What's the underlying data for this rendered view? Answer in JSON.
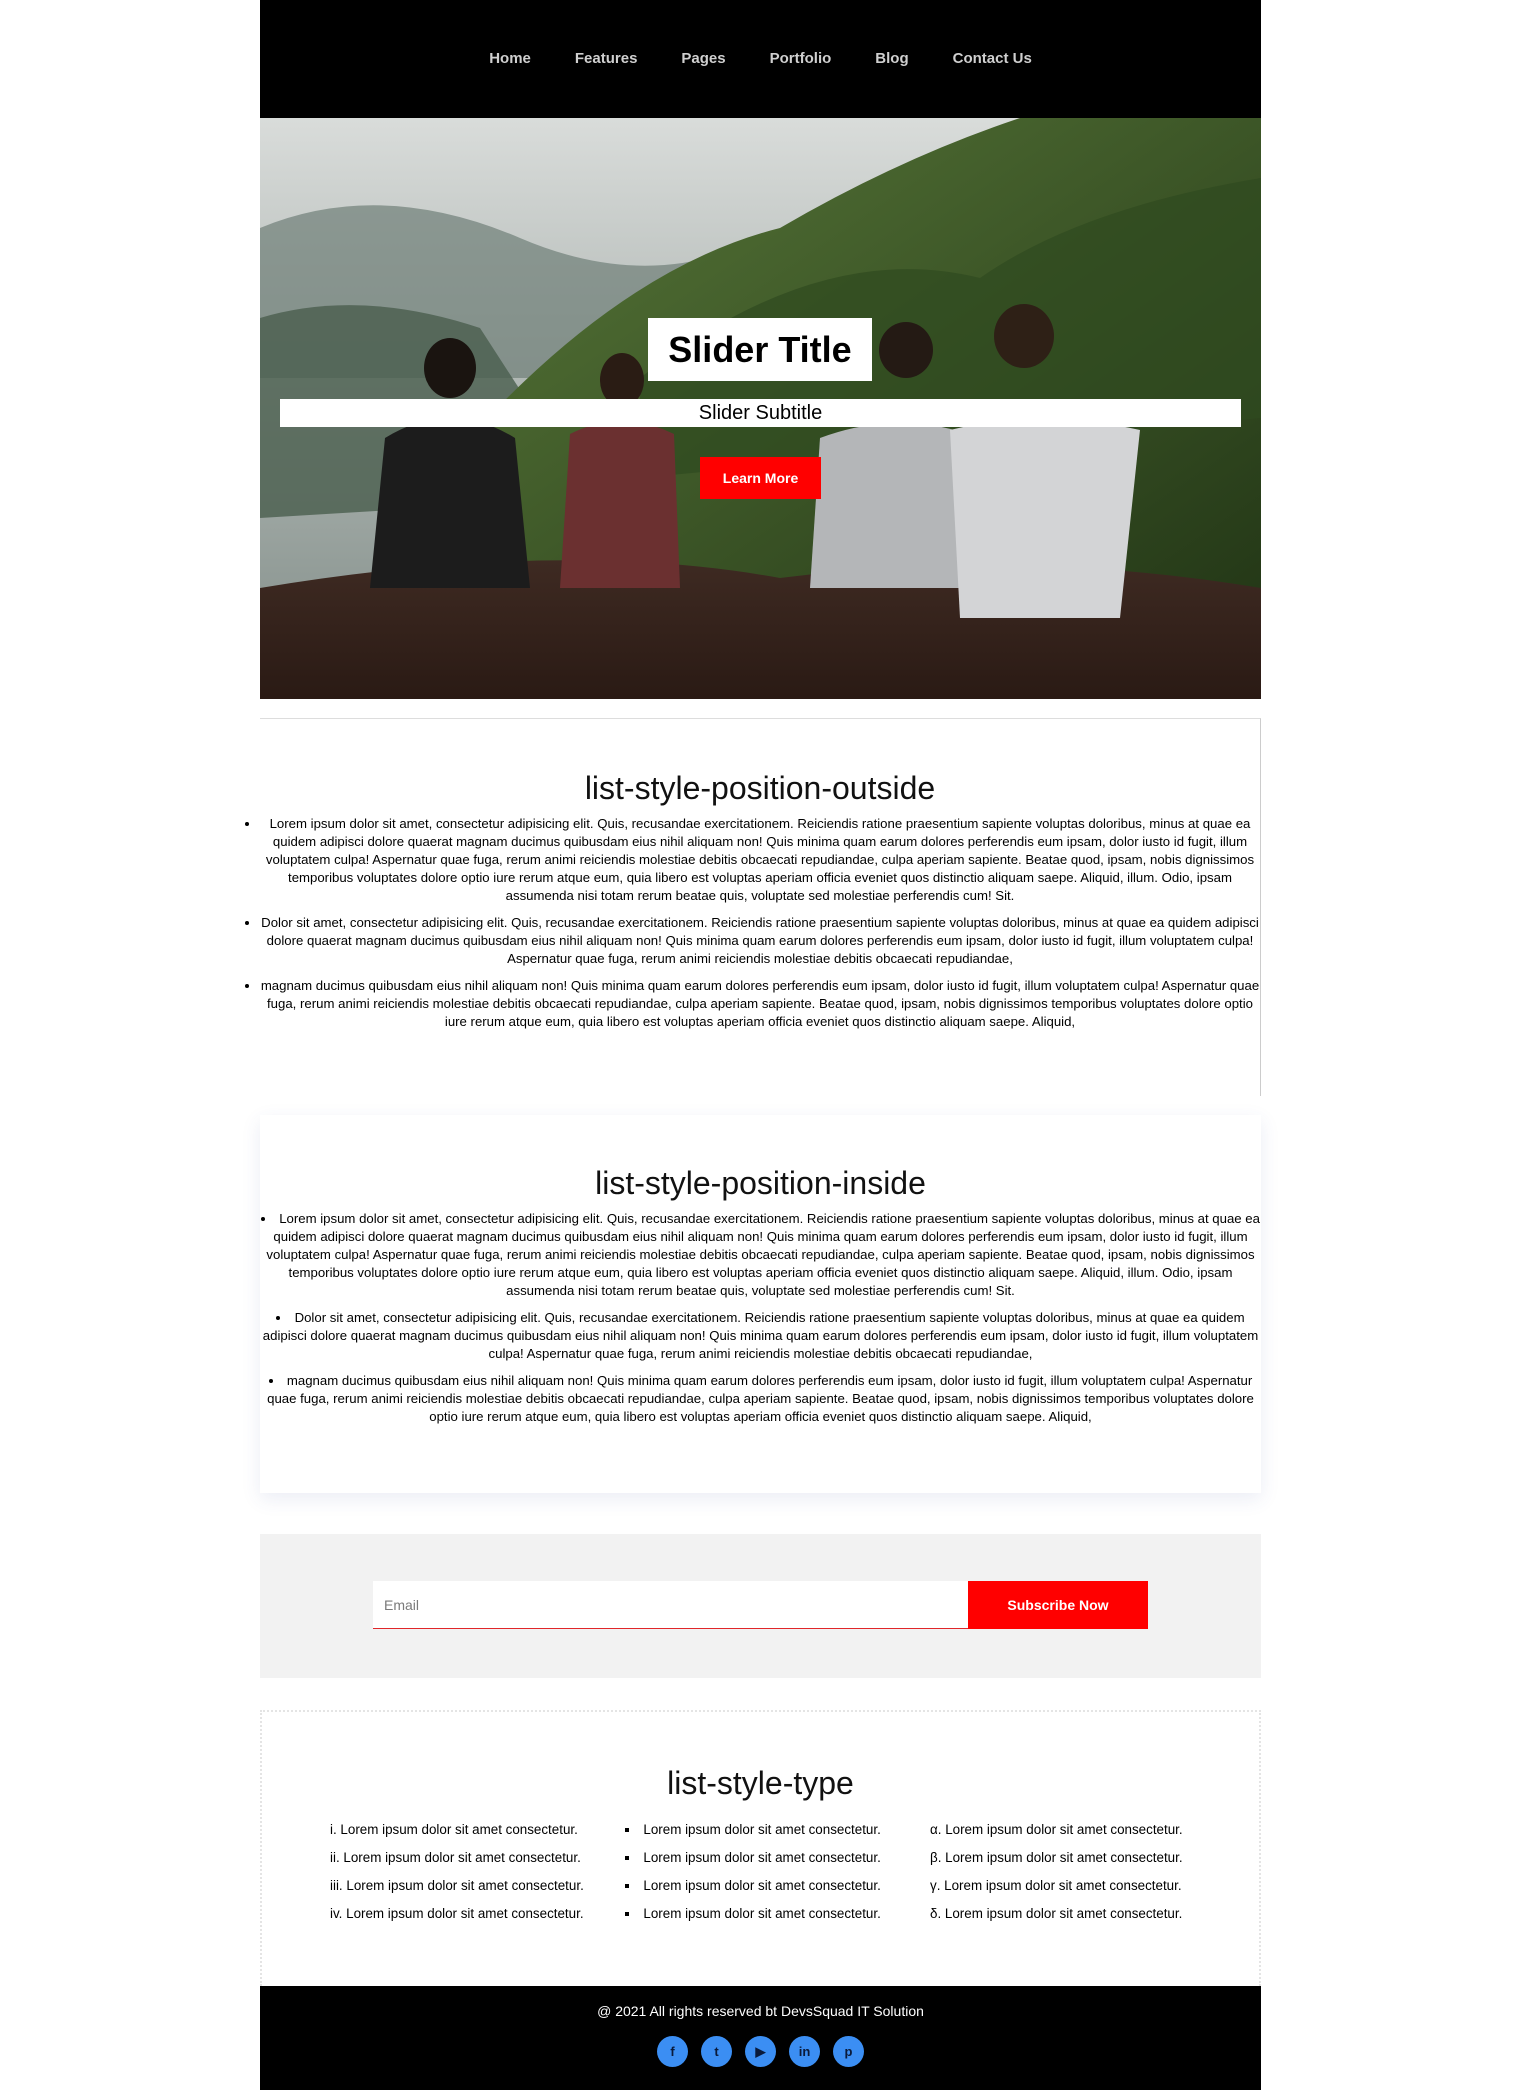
{
  "nav": {
    "items": [
      {
        "label": "Home"
      },
      {
        "label": "Features"
      },
      {
        "label": "Pages"
      },
      {
        "label": "Portfolio"
      },
      {
        "label": "Blog"
      },
      {
        "label": "Contact Us"
      }
    ]
  },
  "hero": {
    "title": "Slider Title",
    "subtitle": "Slider Subtitle",
    "button_label": "Learn More"
  },
  "outside_section": {
    "title": "list-style-position-outside",
    "items": [
      "Lorem ipsum dolor sit amet, consectetur adipisicing elit. Quis, recusandae exercitationem. Reiciendis ratione praesentium sapiente voluptas doloribus, minus at quae ea quidem adipisci dolore quaerat magnam ducimus quibusdam eius nihil aliquam non! Quis minima quam earum dolores perferendis eum ipsam, dolor iusto id fugit, illum voluptatem culpa! Aspernatur quae fuga, rerum animi reiciendis molestiae debitis obcaecati repudiandae, culpa aperiam sapiente. Beatae quod, ipsam, nobis dignissimos temporibus voluptates dolore optio iure rerum atque eum, quia libero est voluptas aperiam officia eveniet quos distinctio aliquam saepe. Aliquid, illum. Odio, ipsam assumenda nisi totam rerum beatae quis, voluptate sed molestiae perferendis cum! Sit.",
      "Dolor sit amet, consectetur adipisicing elit. Quis, recusandae exercitationem. Reiciendis ratione praesentium sapiente voluptas doloribus, minus at quae ea quidem adipisci dolore quaerat magnam ducimus quibusdam eius nihil aliquam non! Quis minima quam earum dolores perferendis eum ipsam, dolor iusto id fugit, illum voluptatem culpa! Aspernatur quae fuga, rerum animi reiciendis molestiae debitis obcaecati repudiandae,",
      "magnam ducimus quibusdam eius nihil aliquam non! Quis minima quam earum dolores perferendis eum ipsam, dolor iusto id fugit, illum voluptatem culpa! Aspernatur quae fuga, rerum animi reiciendis molestiae debitis obcaecati repudiandae, culpa aperiam sapiente. Beatae quod, ipsam, nobis dignissimos temporibus voluptates dolore optio iure rerum atque eum, quia libero est voluptas aperiam officia eveniet quos distinctio aliquam saepe. Aliquid,"
    ]
  },
  "inside_section": {
    "title": "list-style-position-inside",
    "items": [
      "Lorem ipsum dolor sit amet, consectetur adipisicing elit. Quis, recusandae exercitationem. Reiciendis ratione praesentium sapiente voluptas doloribus, minus at quae ea quidem adipisci dolore quaerat magnam ducimus quibusdam eius nihil aliquam non! Quis minima quam earum dolores perferendis eum ipsam, dolor iusto id fugit, illum voluptatem culpa! Aspernatur quae fuga, rerum animi reiciendis molestiae debitis obcaecati repudiandae, culpa aperiam sapiente. Beatae quod, ipsam, nobis dignissimos temporibus voluptates dolore optio iure rerum atque eum, quia libero est voluptas aperiam officia eveniet quos distinctio aliquam saepe. Aliquid, illum. Odio, ipsam assumenda nisi totam rerum beatae quis, voluptate sed molestiae perferendis cum! Sit.",
      "Dolor sit amet, consectetur adipisicing elit. Quis, recusandae exercitationem. Reiciendis ratione praesentium sapiente voluptas doloribus, minus at quae ea quidem adipisci dolore quaerat magnam ducimus quibusdam eius nihil aliquam non! Quis minima quam earum dolores perferendis eum ipsam, dolor iusto id fugit, illum voluptatem culpa! Aspernatur quae fuga, rerum animi reiciendis molestiae debitis obcaecati repudiandae,",
      "magnam ducimus quibusdam eius nihil aliquam non! Quis minima quam earum dolores perferendis eum ipsam, dolor iusto id fugit, illum voluptatem culpa! Aspernatur quae fuga, rerum animi reiciendis molestiae debitis obcaecati repudiandae, culpa aperiam sapiente. Beatae quod, ipsam, nobis dignissimos temporibus voluptates dolore optio iure rerum atque eum, quia libero est voluptas aperiam officia eveniet quos distinctio aliquam saepe. Aliquid,"
    ]
  },
  "subscribe": {
    "email_placeholder": "Email",
    "button_label": "Subscribe Now"
  },
  "type_section": {
    "title": "list-style-type",
    "roman_items": [
      "Lorem ipsum dolor sit amet consectetur.",
      "Lorem ipsum dolor sit amet consectetur.",
      "Lorem ipsum dolor sit amet consectetur.",
      "Lorem ipsum dolor sit amet consectetur."
    ],
    "square_items": [
      "Lorem ipsum dolor sit amet consectetur.",
      "Lorem ipsum dolor sit amet consectetur.",
      "Lorem ipsum dolor sit amet consectetur.",
      "Lorem ipsum dolor sit amet consectetur."
    ],
    "greek_items": [
      "Lorem ipsum dolor sit amet consectetur.",
      "Lorem ipsum dolor sit amet consectetur.",
      "Lorem ipsum dolor sit amet consectetur.",
      "Lorem ipsum dolor sit amet consectetur."
    ]
  },
  "footer": {
    "copyright": "@ 2021 All rights reserved bt DevsSquad IT Solution",
    "socials": [
      {
        "icon": "facebook-icon",
        "glyph": "f"
      },
      {
        "icon": "twitter-icon",
        "glyph": "t"
      },
      {
        "icon": "youtube-icon",
        "glyph": "▶"
      },
      {
        "icon": "linkedin-icon",
        "glyph": "in"
      },
      {
        "icon": "pinterest-icon",
        "glyph": "p"
      }
    ]
  },
  "colors": {
    "accent": "#ff0000",
    "nav_bg": "#000000",
    "subscribe_bg": "#f2f2f2",
    "social_bg": "#3b8ef3"
  }
}
